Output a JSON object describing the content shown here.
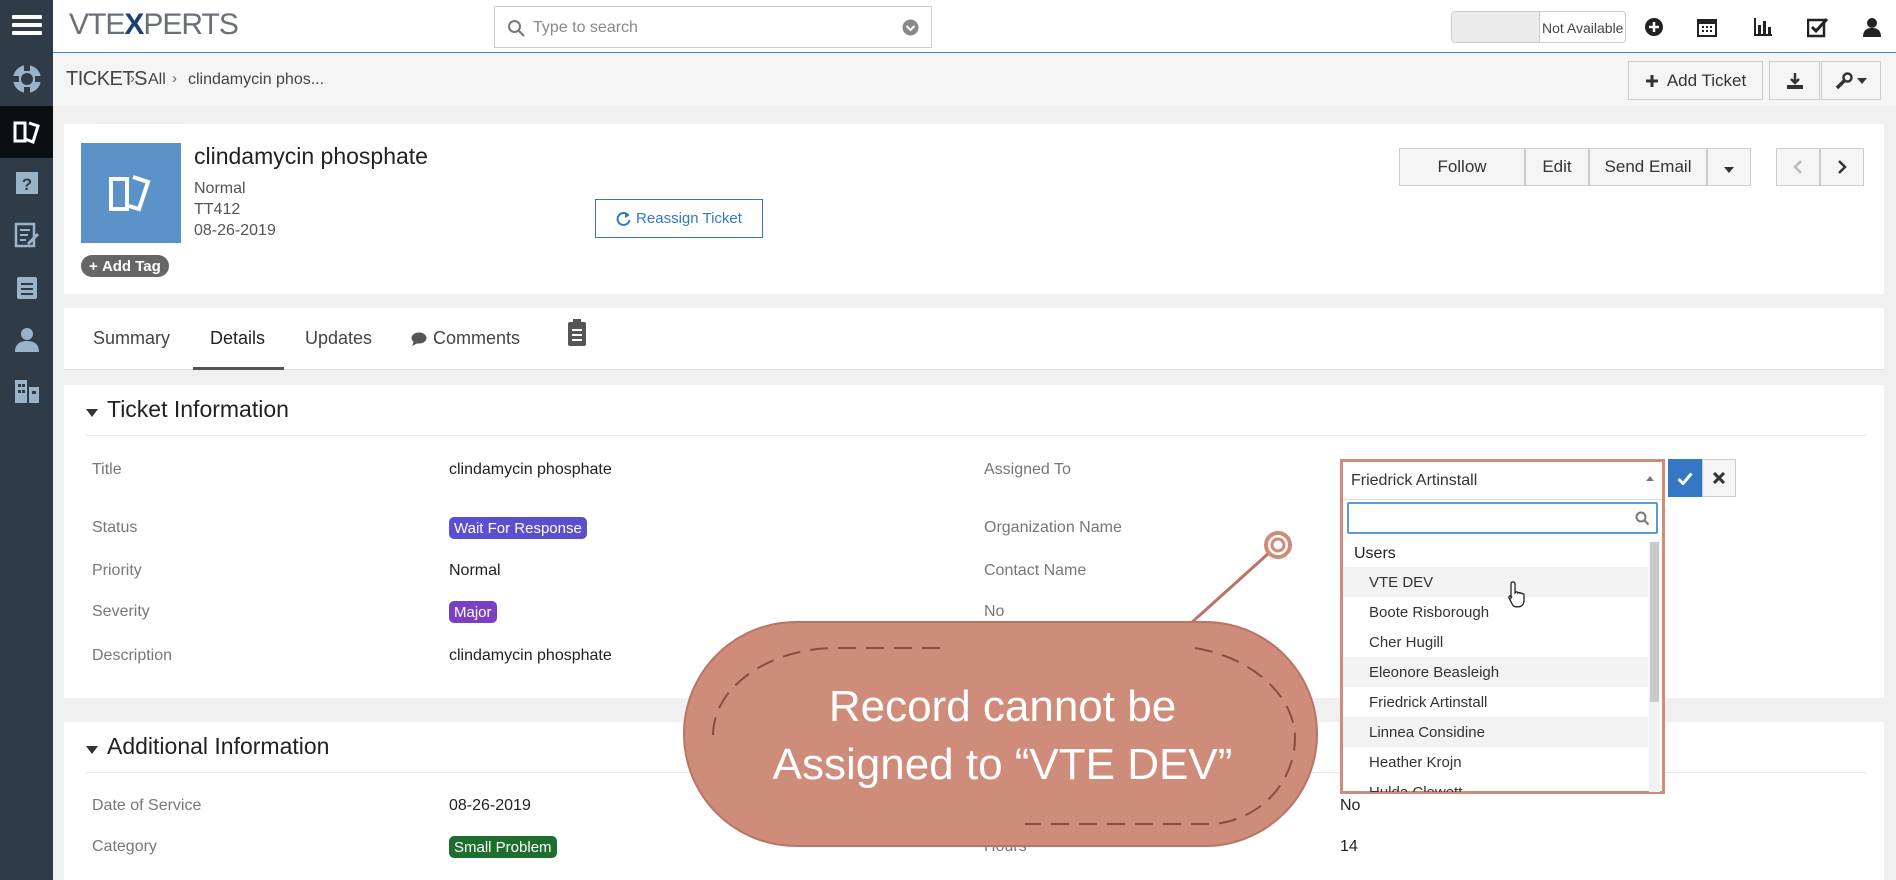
{
  "app": {
    "logo_prefix": "VTE",
    "logo_x": "X",
    "logo_suffix": "PERTS"
  },
  "search": {
    "placeholder": "Type to search"
  },
  "status_toggle": {
    "label": "Not Available"
  },
  "breadcrumb": {
    "module": "TICKETS",
    "filter": "All",
    "record": "clindamycin phos..."
  },
  "actions": {
    "add_ticket": "Add Ticket",
    "follow": "Follow",
    "edit": "Edit",
    "send_email": "Send Email"
  },
  "record": {
    "name": "clindamycin phosphate",
    "priority": "Normal",
    "number": "TT412",
    "date": "08-26-2019",
    "add_tag": "Add Tag",
    "reassign": "Reassign Ticket"
  },
  "tabs": [
    "Summary",
    "Details",
    "Updates",
    "Comments"
  ],
  "ticket_info": {
    "title": "Ticket Information",
    "fields": {
      "title_label": "Title",
      "title_value": "clindamycin phosphate",
      "status_label": "Status",
      "status_value": "Wait For Response",
      "priority_label": "Priority",
      "priority_value": "Normal",
      "severity_label": "Severity",
      "severity_value": "Major",
      "description_label": "Description",
      "description_value": "clindamycin phosphate",
      "assigned_label": "Assigned To",
      "org_label": "Organization Name",
      "contact_label": "Contact Name",
      "no_label": "No"
    }
  },
  "additional_info": {
    "title": "Additional Information",
    "date_label": "Date of Service",
    "date_value": "08-26-2019",
    "category_label": "Category",
    "category_value": "Small Problem",
    "hours_label": "Hours",
    "hours_value": "14",
    "right_value": "No"
  },
  "assign_dropdown": {
    "selected": "Friedrick Artinstall",
    "group": "Users",
    "options": [
      "VTE DEV",
      "Boote Risborough",
      "Cher Hugill",
      "Eleonore Beasleigh",
      "Friedrick Artinstall",
      "Linnea Considine",
      "Heather Krojn",
      "Hulda Clewett"
    ]
  },
  "callout": {
    "line1": "Record cannot be",
    "line2": "Assigned to “VTE DEV”"
  },
  "colors": {
    "sidebar": "#2f3c48",
    "accent": "#3477c4",
    "status_badge": "#5a4fcf",
    "severity_badge": "#7b3fc4",
    "category_badge": "#1e6e2e",
    "callout": "#cf8c7a"
  }
}
